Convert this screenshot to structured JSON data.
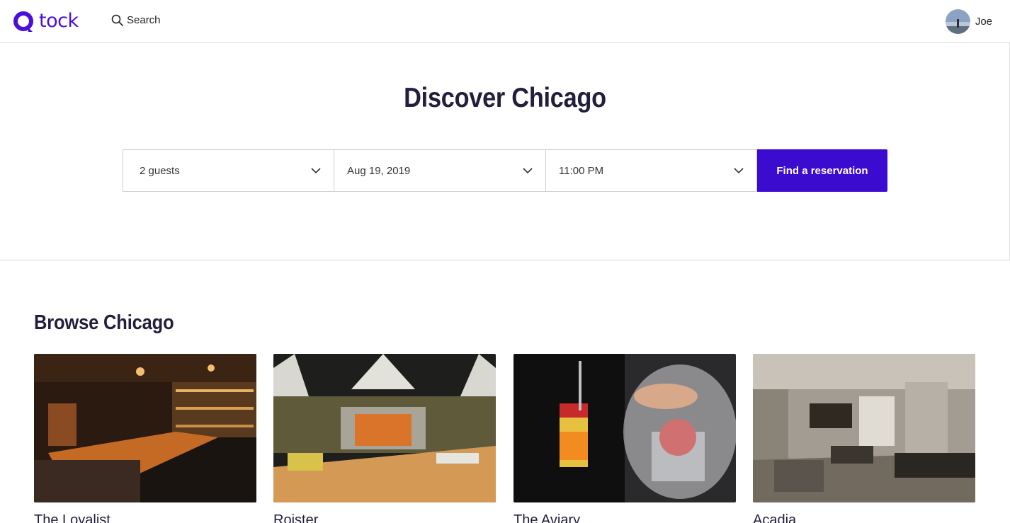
{
  "header": {
    "logo_text": "tock",
    "search_label": "Search",
    "user_name": "Joe"
  },
  "hero": {
    "title": "Discover Chicago",
    "guests": "2 guests",
    "date": "Aug 19, 2019",
    "time": "11:00 PM",
    "find_button": "Find a reservation"
  },
  "browse": {
    "title": "Browse Chicago",
    "restaurants": [
      {
        "name": "The Loyalist"
      },
      {
        "name": "Roister"
      },
      {
        "name": "The Aviary"
      },
      {
        "name": "Acadia"
      }
    ]
  },
  "colors": {
    "brand": "#4a0fd9",
    "button": "#3c0bd0",
    "heading": "#221f3d"
  }
}
